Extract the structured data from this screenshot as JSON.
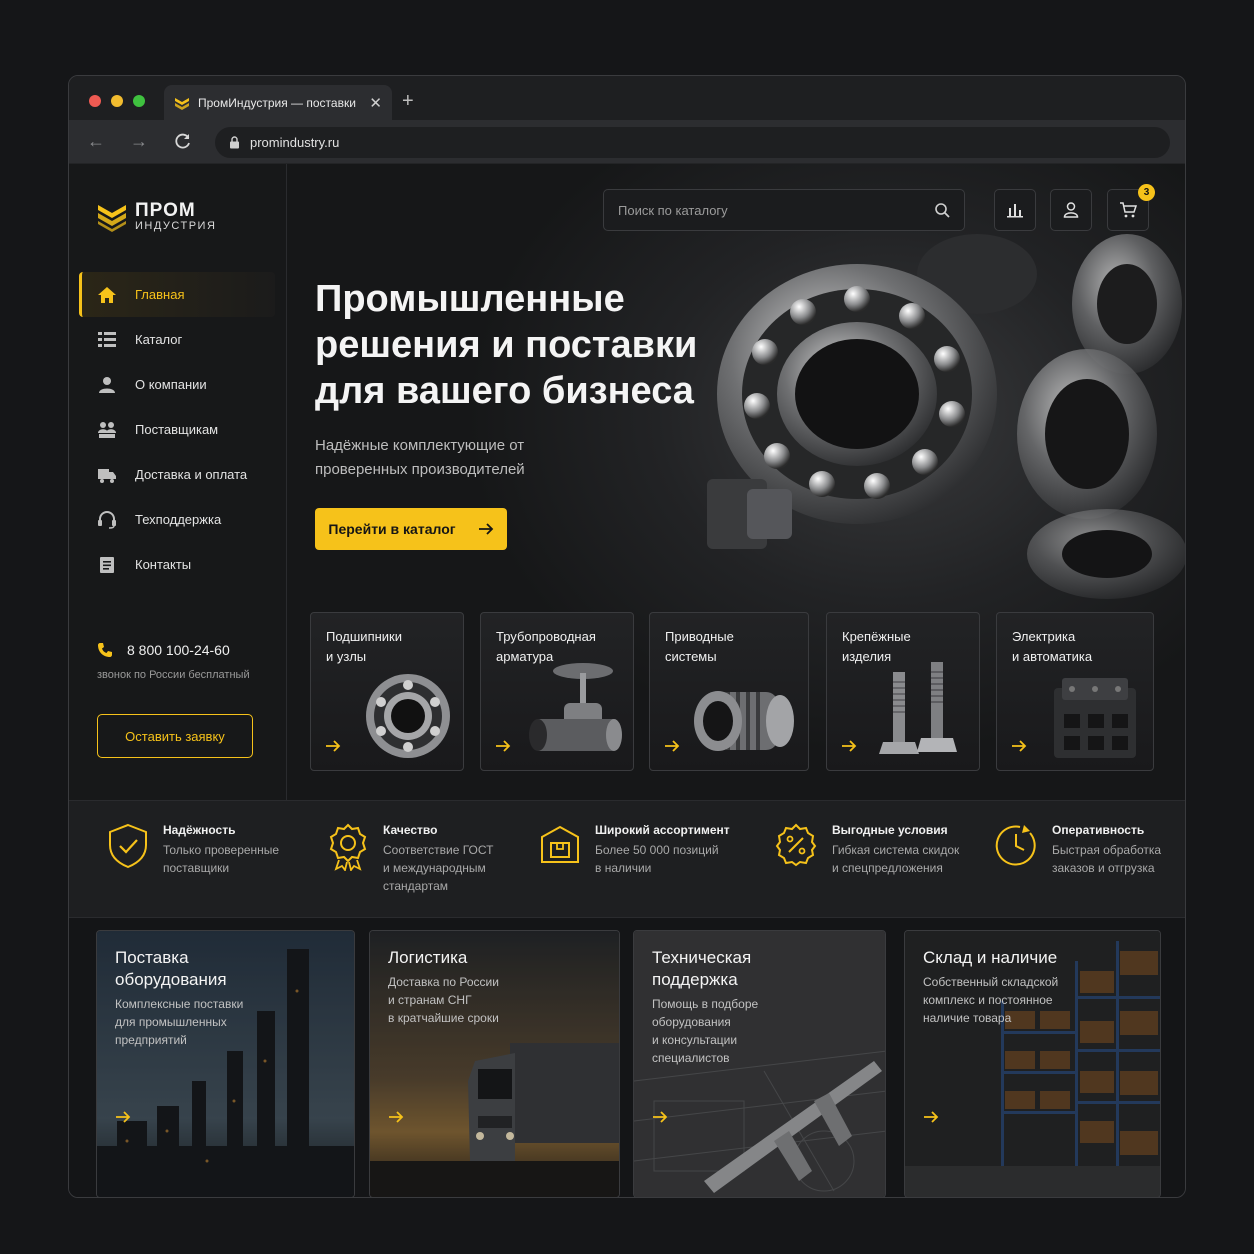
{
  "browser": {
    "tab_title": "ПромИндустрия — поставки",
    "url": "promindustry.ru"
  },
  "brand": {
    "line1": "ПРОМ",
    "line2": "ИНДУСТРИЯ"
  },
  "sidebar": {
    "items": [
      {
        "label": "Главная",
        "icon": "home-icon",
        "active": true
      },
      {
        "label": "Каталог",
        "icon": "catalog-icon"
      },
      {
        "label": "О компании",
        "icon": "user-icon"
      },
      {
        "label": "Поставщикам",
        "icon": "partners-icon"
      },
      {
        "label": "Доставка и оплата",
        "icon": "truck-icon"
      },
      {
        "label": "Техподдержка",
        "icon": "headset-icon"
      },
      {
        "label": "Контакты",
        "icon": "document-icon"
      }
    ],
    "phone": "8 800 100-24-60",
    "phone_note": "звонок по России бесплатный",
    "request_button": "Оставить заявку"
  },
  "header": {
    "search_placeholder": "Поиск по каталогу",
    "cart_count": "3"
  },
  "hero": {
    "title": "Промышленные решения и поставки для вашего бизнеса",
    "subtitle": "Надёжные комплектующие от проверенных производителей",
    "cta": "Перейти в каталог"
  },
  "categories": [
    {
      "label": "Подшипники\nи узлы"
    },
    {
      "label": "Трубопроводная\nарматура"
    },
    {
      "label": "Приводные\nсистемы"
    },
    {
      "label": "Крепёжные\nизделия"
    },
    {
      "label": "Электрика\nи автоматика"
    }
  ],
  "features": [
    {
      "title": "Надёжность",
      "desc": "Только проверенные\nпоставщики"
    },
    {
      "title": "Качество",
      "desc": "Соответствие ГОСТ\nи международным\nстандартам"
    },
    {
      "title": "Широкий ассортимент",
      "desc": "Более 50 000 позиций\nв наличии"
    },
    {
      "title": "Выгодные условия",
      "desc": "Гибкая система скидок\nи спецпредложения"
    },
    {
      "title": "Оперативность",
      "desc": "Быстрая обработка\nзаказов и отгрузка"
    }
  ],
  "services": [
    {
      "title": "Поставка\nоборудования",
      "desc": "Комплексные поставки\nдля промышленных\nпредприятий"
    },
    {
      "title": "Логистика",
      "desc": "Доставка по России\nи странам СНГ\nв кратчайшие сроки"
    },
    {
      "title": "Техническая\nподдержка",
      "desc": "Помощь в подборе\nоборудования\nи консультации\nспециалистов"
    },
    {
      "title": "Склад и наличие",
      "desc": "Собственный складской\nкомплекс и постоянное\nналичие товара"
    }
  ],
  "colors": {
    "accent": "#f6c21a",
    "background": "#141517"
  }
}
